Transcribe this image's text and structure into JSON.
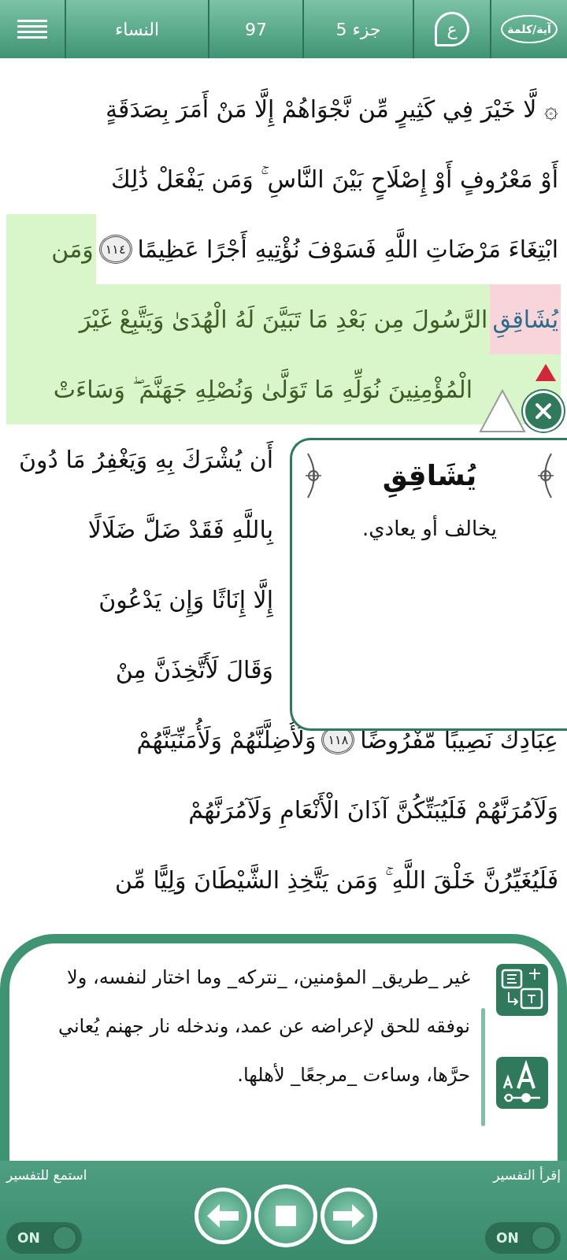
{
  "top_bar": {
    "mode_label": "آية/كلمة",
    "tafsir_label": "ع",
    "juz": "جزء 5",
    "page": "97",
    "surah": "النساء"
  },
  "quran_lines": [
    {
      "kind": "full",
      "segments": [
        {
          "kind": "text",
          "text": "۞ لَّا خَيْرَ فِي كَثِيرٍ مِّن نَّجْوَاهُمْ إِلَّا مَنْ أَمَرَ بِصَدَقَةٍ",
          "highlighted": false,
          "selected": false
        }
      ]
    },
    {
      "kind": "full",
      "segments": [
        {
          "kind": "text",
          "text": "أَوْ مَعْرُوفٍ أَوْ إِصْلَاحٍ بَيْنَ النَّاسِ ۚ وَمَن يَفْعَلْ ذَٰلِكَ",
          "highlighted": false,
          "selected": false
        }
      ]
    },
    {
      "kind": "full",
      "segments": [
        {
          "kind": "text",
          "text": "ابْتِغَاءَ مَرْضَاتِ اللَّهِ فَسَوْفَ نُؤْتِيهِ أَجْرًا عَظِيمًا",
          "highlighted": false,
          "selected": false
        },
        {
          "kind": "marker",
          "text": "١١٤",
          "highlighted": false
        },
        {
          "kind": "text",
          "text": "وَمَن",
          "highlighted": true,
          "selected": false
        }
      ]
    },
    {
      "kind": "full",
      "segments": [
        {
          "kind": "text",
          "text": "يُشَاقِقِ",
          "highlighted": true,
          "selected": true
        },
        {
          "kind": "text",
          "text": "الرَّسُولَ مِن بَعْدِ مَا تَبَيَّنَ لَهُ الْهُدَىٰ وَيَتَّبِعْ غَيْرَ",
          "highlighted": true,
          "selected": false
        }
      ]
    },
    {
      "kind": "beside_close",
      "segments": [
        {
          "kind": "text",
          "text": "الْمُؤْمِنِينَ نُوَلِّهِ مَا تَوَلَّىٰ وَنُصْلِهِ جَهَنَّمَ ۖ وَسَاءَتْ",
          "highlighted": true,
          "selected": false
        }
      ]
    },
    {
      "kind": "beside_popup",
      "segments": [
        {
          "kind": "text",
          "text": "أَن يُشْرَكَ بِهِ وَيَغْفِرُ مَا دُونَ",
          "highlighted": false,
          "selected": false
        }
      ]
    },
    {
      "kind": "beside_popup",
      "segments": [
        {
          "kind": "text",
          "text": "بِاللَّهِ فَقَدْ ضَلَّ ضَلَالًا",
          "highlighted": false,
          "selected": false
        }
      ]
    },
    {
      "kind": "beside_popup",
      "segments": [
        {
          "kind": "text",
          "text": "إِلَّا إِنَاثًا وَإِن يَدْعُونَ",
          "highlighted": false,
          "selected": false
        }
      ]
    },
    {
      "kind": "beside_popup",
      "segments": [
        {
          "kind": "text",
          "text": "وَقَالَ لَأَتَّخِذَنَّ مِنْ",
          "highlighted": false,
          "selected": false
        }
      ]
    },
    {
      "kind": "full",
      "segments": [
        {
          "kind": "text",
          "text": "عِبَادِكَ نَصِيبًا مَّفْرُوضًا",
          "highlighted": false,
          "selected": false
        },
        {
          "kind": "marker",
          "text": "١١٨",
          "highlighted": false
        },
        {
          "kind": "text",
          "text": "وَلَأُضِلَّنَّهُمْ وَلَأُمَنِّيَنَّهُمْ",
          "highlighted": false,
          "selected": false
        }
      ]
    },
    {
      "kind": "full",
      "segments": [
        {
          "kind": "text",
          "text": "وَلَآمُرَنَّهُمْ فَلَيُبَتِّكُنَّ آذَانَ الْأَنْعَامِ وَلَآمُرَنَّهُمْ",
          "highlighted": false,
          "selected": false
        }
      ]
    },
    {
      "kind": "full",
      "segments": [
        {
          "kind": "text",
          "text": "فَلَيُغَيِّرُنَّ خَلْقَ اللَّهِ ۚ وَمَن يَتَّخِذِ الشَّيْطَانَ وَلِيًّا مِّن",
          "highlighted": false,
          "selected": false
        }
      ]
    }
  ],
  "word_popup": {
    "word": "يُشَاقِقِ",
    "meaning": "يخالف أو يعادي."
  },
  "tafsir_panel": {
    "text": "غير _طريق_ المؤمنين، _نتركه_ وما اختار لنفسه، ولا نوفقه للحق لإعراضه عن عمد، وندخله نار جهنم يُعاني حرَّها، وساءت _مرجعًا_ لأهلها."
  },
  "bottom_bar": {
    "read_label": "إقرأ التفسير",
    "listen_label": "استمع للتفسير",
    "read_toggle": {
      "label": "ON",
      "on": true
    },
    "listen_toggle": {
      "label": "ON",
      "on": true
    }
  }
}
